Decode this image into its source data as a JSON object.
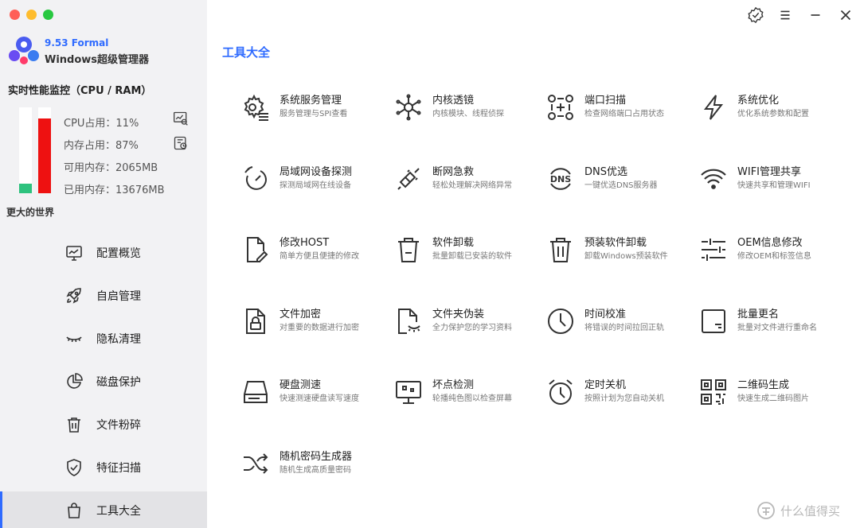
{
  "window": {
    "traffic_lights": [
      "#ff5f57",
      "#febc2e",
      "#28c840"
    ]
  },
  "app": {
    "version": "9.53 Formal",
    "name": "Windows超级管理器"
  },
  "monitor": {
    "title": "实时性能监控（CPU / RAM）",
    "cpu_level": 0.11,
    "ram_level": 0.87,
    "cpu_color": "#2ec27e",
    "ram_color": "#ee1111",
    "stats": [
      "CPU占用：11%",
      "内存占用：87%",
      "可用内存：2065MB",
      "已用内存：13676MB"
    ]
  },
  "world_label": "更大的世界",
  "nav": [
    {
      "label": "配置概览",
      "icon": "monitor-icon"
    },
    {
      "label": "自启管理",
      "icon": "rocket-icon"
    },
    {
      "label": "隐私清理",
      "icon": "eye-closed-icon"
    },
    {
      "label": "磁盘保护",
      "icon": "pie-chart-icon"
    },
    {
      "label": "文件粉碎",
      "icon": "trash-icon"
    },
    {
      "label": "特征扫描",
      "icon": "shield-check-icon"
    },
    {
      "label": "工具大全",
      "icon": "bag-icon",
      "active": true
    }
  ],
  "topbar": {
    "icons": [
      "verified-icon",
      "menu-icon",
      "minimize-icon",
      "close-icon"
    ]
  },
  "page_title": "工具大全",
  "tools": [
    {
      "name": "系统服务管理",
      "desc": "服务管理与SPI查看",
      "icon": "gear-list-icon"
    },
    {
      "name": "内核透镜",
      "desc": "内核模块、线程侦探",
      "icon": "kernel-icon"
    },
    {
      "name": "端口扫描",
      "desc": "检查网络端口占用状态",
      "icon": "port-scan-icon"
    },
    {
      "name": "系统优化",
      "desc": "优化系统参数和配置",
      "icon": "lightning-icon"
    },
    {
      "name": "局域网设备探测",
      "desc": "探测局域网在线设备",
      "icon": "radar-icon"
    },
    {
      "name": "断网急救",
      "desc": "轻松处理解决网络异常",
      "icon": "plug-icon"
    },
    {
      "name": "DNS优选",
      "desc": "一键优选DNS服务器",
      "icon": "dns-icon"
    },
    {
      "name": "WIFI管理共享",
      "desc": "快速共享和管理WIFI",
      "icon": "wifi-icon"
    },
    {
      "name": "修改HOST",
      "desc": "简单方便且便捷的修改",
      "icon": "file-edit-icon"
    },
    {
      "name": "软件卸载",
      "desc": "批量卸载已安装的软件",
      "icon": "bin-icon"
    },
    {
      "name": "预装软件卸载",
      "desc": "卸载Windows预装软件",
      "icon": "bin-lines-icon"
    },
    {
      "name": "OEM信息修改",
      "desc": "修改OEM和标签信息",
      "icon": "sliders-icon"
    },
    {
      "name": "文件加密",
      "desc": "对重要的数据进行加密",
      "icon": "file-lock-icon"
    },
    {
      "name": "文件夹伪装",
      "desc": "全力保护您的学习资料",
      "icon": "file-disguise-icon"
    },
    {
      "name": "时间校准",
      "desc": "将错误的时间拉回正轨",
      "icon": "clock-icon"
    },
    {
      "name": "批量更名",
      "desc": "批量对文件进行重命名",
      "icon": "rename-icon"
    },
    {
      "name": "硬盘测速",
      "desc": "快速测速硬盘读写速度",
      "icon": "hard-drive-icon"
    },
    {
      "name": "坏点检测",
      "desc": "轮播纯色图以检查屏幕",
      "icon": "screen-icon"
    },
    {
      "name": "定时关机",
      "desc": "按照计划为您自动关机",
      "icon": "alarm-clock-icon"
    },
    {
      "name": "二维码生成",
      "desc": "快速生成二维码图片",
      "icon": "qr-code-icon"
    },
    {
      "name": "随机密码生成器",
      "desc": "随机生成高质量密码",
      "icon": "shuffle-icon"
    }
  ],
  "watermark": {
    "text": "什么值得买",
    "icon": "smzdm-logo-icon"
  }
}
